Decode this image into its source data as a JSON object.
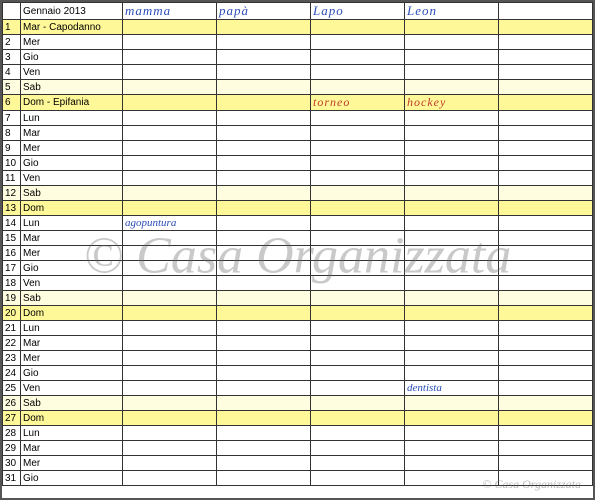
{
  "header": {
    "month_label": "Gennaio 2013",
    "columns": [
      "mamma",
      "papà",
      "Lapo",
      "Leon",
      ""
    ]
  },
  "rows": [
    {
      "num": "1",
      "day": "Mar",
      "holiday": "Capodanno",
      "highlight": "yellow",
      "cells": [
        "",
        "",
        "",
        "",
        ""
      ]
    },
    {
      "num": "2",
      "day": "Mer",
      "cells": [
        "",
        "",
        "",
        "",
        ""
      ]
    },
    {
      "num": "3",
      "day": "Gio",
      "cells": [
        "",
        "",
        "",
        "",
        ""
      ]
    },
    {
      "num": "4",
      "day": "Ven",
      "cells": [
        "",
        "",
        "",
        "",
        ""
      ]
    },
    {
      "num": "5",
      "day": "Sab",
      "highlight": "lightyellow",
      "cells": [
        "",
        "",
        "",
        "",
        ""
      ]
    },
    {
      "num": "6",
      "day": "Dom",
      "holiday": "Epifania",
      "highlight": "yellow",
      "cells": [
        "",
        "",
        "torneo",
        "hockey",
        ""
      ],
      "cellClass": "hand-red"
    },
    {
      "num": "7",
      "day": "Lun",
      "cells": [
        "",
        "",
        "",
        "",
        ""
      ]
    },
    {
      "num": "8",
      "day": "Mar",
      "cells": [
        "",
        "",
        "",
        "",
        ""
      ]
    },
    {
      "num": "9",
      "day": "Mer",
      "cells": [
        "",
        "",
        "",
        "",
        ""
      ]
    },
    {
      "num": "10",
      "day": "Gio",
      "cells": [
        "",
        "",
        "",
        "",
        ""
      ]
    },
    {
      "num": "11",
      "day": "Ven",
      "cells": [
        "",
        "",
        "",
        "",
        ""
      ]
    },
    {
      "num": "12",
      "day": "Sab",
      "highlight": "lightyellow",
      "cells": [
        "",
        "",
        "",
        "",
        ""
      ]
    },
    {
      "num": "13",
      "day": "Dom",
      "highlight": "yellow",
      "cells": [
        "",
        "",
        "",
        "",
        ""
      ]
    },
    {
      "num": "14",
      "day": "Lun",
      "cells": [
        "agopuntura",
        "",
        "",
        "",
        ""
      ],
      "cellClass": "hand-entry"
    },
    {
      "num": "15",
      "day": "Mar",
      "cells": [
        "",
        "",
        "",
        "",
        ""
      ]
    },
    {
      "num": "16",
      "day": "Mer",
      "cells": [
        "",
        "",
        "",
        "",
        ""
      ]
    },
    {
      "num": "17",
      "day": "Gio",
      "cells": [
        "",
        "",
        "",
        "",
        ""
      ]
    },
    {
      "num": "18",
      "day": "Ven",
      "cells": [
        "",
        "",
        "",
        "",
        ""
      ]
    },
    {
      "num": "19",
      "day": "Sab",
      "highlight": "lightyellow",
      "cells": [
        "",
        "",
        "",
        "",
        ""
      ]
    },
    {
      "num": "20",
      "day": "Dom",
      "highlight": "yellow",
      "cells": [
        "",
        "",
        "",
        "",
        ""
      ]
    },
    {
      "num": "21",
      "day": "Lun",
      "cells": [
        "",
        "",
        "",
        "",
        ""
      ]
    },
    {
      "num": "22",
      "day": "Mar",
      "cells": [
        "",
        "",
        "",
        "",
        ""
      ]
    },
    {
      "num": "23",
      "day": "Mer",
      "cells": [
        "",
        "",
        "",
        "",
        ""
      ]
    },
    {
      "num": "24",
      "day": "Gio",
      "cells": [
        "",
        "",
        "",
        "",
        ""
      ]
    },
    {
      "num": "25",
      "day": "Ven",
      "cells": [
        "",
        "",
        "",
        "dentista",
        ""
      ],
      "cellClass": "hand-entry"
    },
    {
      "num": "26",
      "day": "Sab",
      "highlight": "lightyellow",
      "cells": [
        "",
        "",
        "",
        "",
        ""
      ]
    },
    {
      "num": "27",
      "day": "Dom",
      "highlight": "yellow",
      "cells": [
        "",
        "",
        "",
        "",
        ""
      ]
    },
    {
      "num": "28",
      "day": "Lun",
      "cells": [
        "",
        "",
        "",
        "",
        ""
      ]
    },
    {
      "num": "29",
      "day": "Mar",
      "cells": [
        "",
        "",
        "",
        "",
        ""
      ]
    },
    {
      "num": "30",
      "day": "Mer",
      "cells": [
        "",
        "",
        "",
        "",
        ""
      ]
    },
    {
      "num": "31",
      "day": "Gio",
      "cells": [
        "",
        "",
        "",
        "",
        ""
      ]
    }
  ],
  "watermark": "© Casa Organizzata",
  "watermark_small": "© Casa Organizzata",
  "day_holiday_sep": " - "
}
